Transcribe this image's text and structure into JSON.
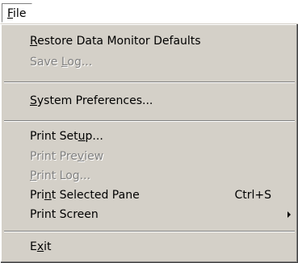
{
  "menubar": {
    "file_prefix": "",
    "file_mnemonic": "F",
    "file_suffix": "ile"
  },
  "menu": {
    "restore": {
      "pre": "",
      "mn": "R",
      "post": "estore Data Monitor Defaults"
    },
    "save_log": {
      "pre": "Save ",
      "mn": "L",
      "post": "og..."
    },
    "system_prefs": {
      "pre": "",
      "mn": "S",
      "post": "ystem Preferences..."
    },
    "print_setup": {
      "pre": "Print Set",
      "mn": "u",
      "post": "p..."
    },
    "print_preview": {
      "pre": "Print Pre",
      "mn": "v",
      "post": "iew"
    },
    "print_log": {
      "pre": "",
      "mn": "P",
      "post": "rint Log..."
    },
    "print_selected": {
      "pre": "Pri",
      "mn": "n",
      "post": "t Selected Pane",
      "shortcut": "Ctrl+S"
    },
    "print_screen": {
      "pre": "Print Screen",
      "mn": "",
      "post": ""
    },
    "exit": {
      "pre": "E",
      "mn": "x",
      "post": "it"
    }
  }
}
